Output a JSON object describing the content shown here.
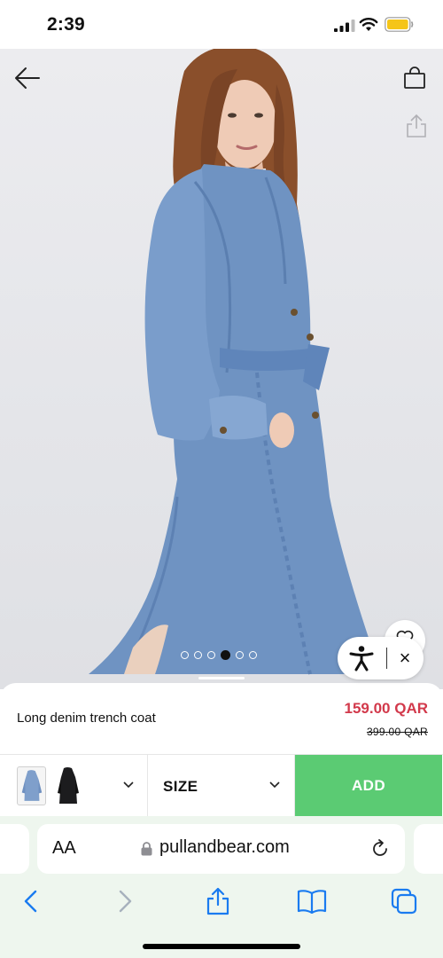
{
  "status_bar": {
    "time": "2:39",
    "icons": [
      "cellular-signal-icon",
      "wifi-icon",
      "battery-icon"
    ],
    "battery_color": "#f5c518"
  },
  "product_image": {
    "carousel": {
      "count": 6,
      "active_index": 3
    },
    "icons": [
      "arrow-left-icon",
      "shopping-bag-icon",
      "share-icon",
      "heart-icon"
    ]
  },
  "accessibility_widget": {
    "icon": "accessibility-person-icon",
    "close_label": "×"
  },
  "product": {
    "name": "Long denim trench coat",
    "price_sale": "159.00 QAR",
    "price_original": "399.00 QAR",
    "sale_color": "#d2394b"
  },
  "actions": {
    "color_swatches": [
      "denim-blue",
      "black"
    ],
    "size_label": "SIZE",
    "add_label": "ADD",
    "add_color": "#5bcb73"
  },
  "browser": {
    "text_size_label": "AA",
    "url": "pullandbear.com",
    "icons": [
      "lock-icon",
      "reload-icon",
      "back-icon",
      "forward-icon",
      "share-icon",
      "bookmarks-icon",
      "tabs-icon"
    ],
    "accent": "#1a7bf0"
  }
}
